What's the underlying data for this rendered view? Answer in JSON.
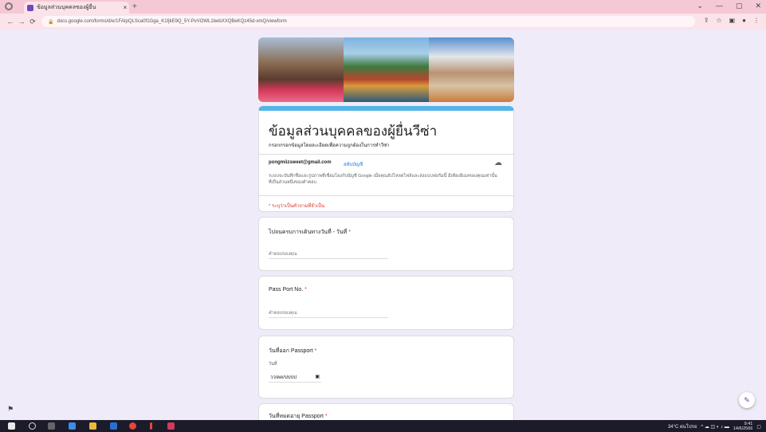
{
  "browser": {
    "tab_title": "ข้อมูลส่วนบุคคลของผู้ยื่น",
    "tab_close": "×",
    "new_tab": "+",
    "url": "docs.google.com/forms/d/e/1FAIpQLSca0f1Gga_K1fjkE9Q_5Y-PvVOWL1bebXXQBeKQz45d-xmQ/viewform",
    "window_controls": [
      "⌄",
      "—",
      "▢",
      "✕"
    ]
  },
  "form": {
    "title": "ข้อมูลส่วนบุคคลของผู้ยื่นวีซ่า",
    "description": "กรอกกรอกข้อมูลโดยละเอียดเพื่อความถูกต้องในการทำวีซ่า",
    "account_email": "pongmiizsweet@gmail.com",
    "switch_account": "สลับบัญชี",
    "notice": "ระบบจะบันทึกชื่อและรูปภาพที่เชื่อมโยงกับบัญชี Google เมื่อคุณอัปโหลดไฟล์และส่งแบบฟอร์มนี้ มีเพียงอีเมลของคุณเท่านั้นที่เป็นส่วนหนึ่งของคำตอบ",
    "required_note": "* ระบุว่าเป็นคำถามที่จำเป็น",
    "questions": [
      {
        "title": "ไปจนครบการเดินทางวันที่ - วันที่",
        "required": "*",
        "placeholder": "คำตอบของคุณ"
      },
      {
        "title": "Pass Port No.",
        "required": "*",
        "placeholder": "คำตอบของคุณ"
      },
      {
        "title": "วันที่ออก Passport",
        "required": "*",
        "sub_label": "วันที่",
        "date_placeholder": "วว/ดด/ปปปป"
      },
      {
        "title": "วันที่หมดอายุ Passport",
        "required": "*"
      }
    ]
  },
  "taskbar": {
    "weather": "34°C ฝนโปรย",
    "time": "9:41",
    "date": "14/6/2566"
  }
}
